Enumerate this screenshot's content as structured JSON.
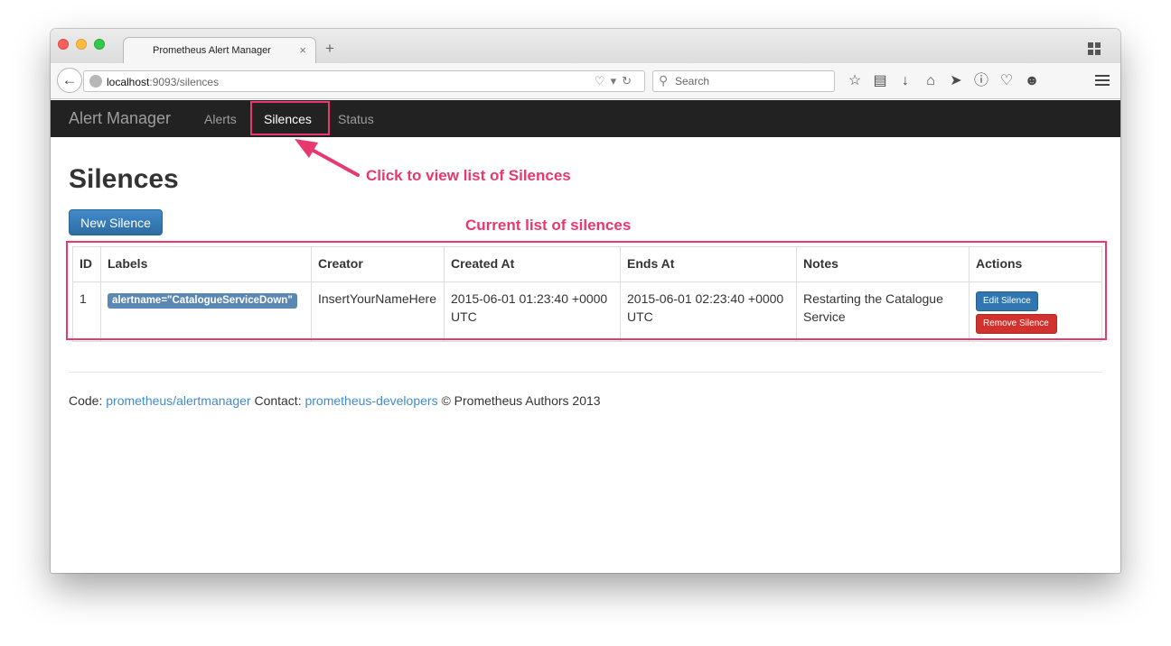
{
  "browser": {
    "tab_title": "Prometheus Alert Manager",
    "tab_close": "×",
    "new_tab": "+",
    "url_host": "localhost",
    "url_path": ":9093/silences",
    "search_placeholder": "Search",
    "toolbar_icons": [
      "star-icon",
      "reading-list-icon",
      "download-icon",
      "home-icon",
      "send-icon",
      "info-icon",
      "pocket-icon",
      "emoji-icon"
    ]
  },
  "app": {
    "brand": "Alert Manager",
    "nav": {
      "alerts": "Alerts",
      "silences": "Silences",
      "status": "Status"
    },
    "active_nav": "silences"
  },
  "page": {
    "title": "Silences",
    "new_silence_label": "New Silence",
    "table": {
      "headers": {
        "id": "ID",
        "labels": "Labels",
        "creator": "Creator",
        "created_at": "Created At",
        "ends_at": "Ends At",
        "notes": "Notes",
        "actions": "Actions"
      },
      "rows": [
        {
          "id": "1",
          "label": "alertname=\"CatalogueServiceDown\"",
          "creator": "InsertYourNameHere",
          "created_at": "2015-06-01 01:23:40 +0000 UTC",
          "ends_at": "2015-06-01 02:23:40 +0000 UTC",
          "notes": "Restarting the Catalogue Service",
          "edit_label": "Edit Silence",
          "remove_label": "Remove Silence"
        }
      ]
    }
  },
  "footer": {
    "code_prefix": "Code:",
    "code_link": "prometheus/alertmanager",
    "contact_prefix": "Contact:",
    "contact_link": "prometheus-developers",
    "copyright": "© Prometheus Authors 2013"
  },
  "annotations": {
    "nav_callout": "Click to view list of Silences",
    "table_callout": "Current list of silences"
  },
  "colors": {
    "annotation": "#e8386d",
    "navbar_bg": "#222222",
    "primary": "#428bca",
    "danger": "#d2322d",
    "label_tag": "#5a87b3"
  }
}
